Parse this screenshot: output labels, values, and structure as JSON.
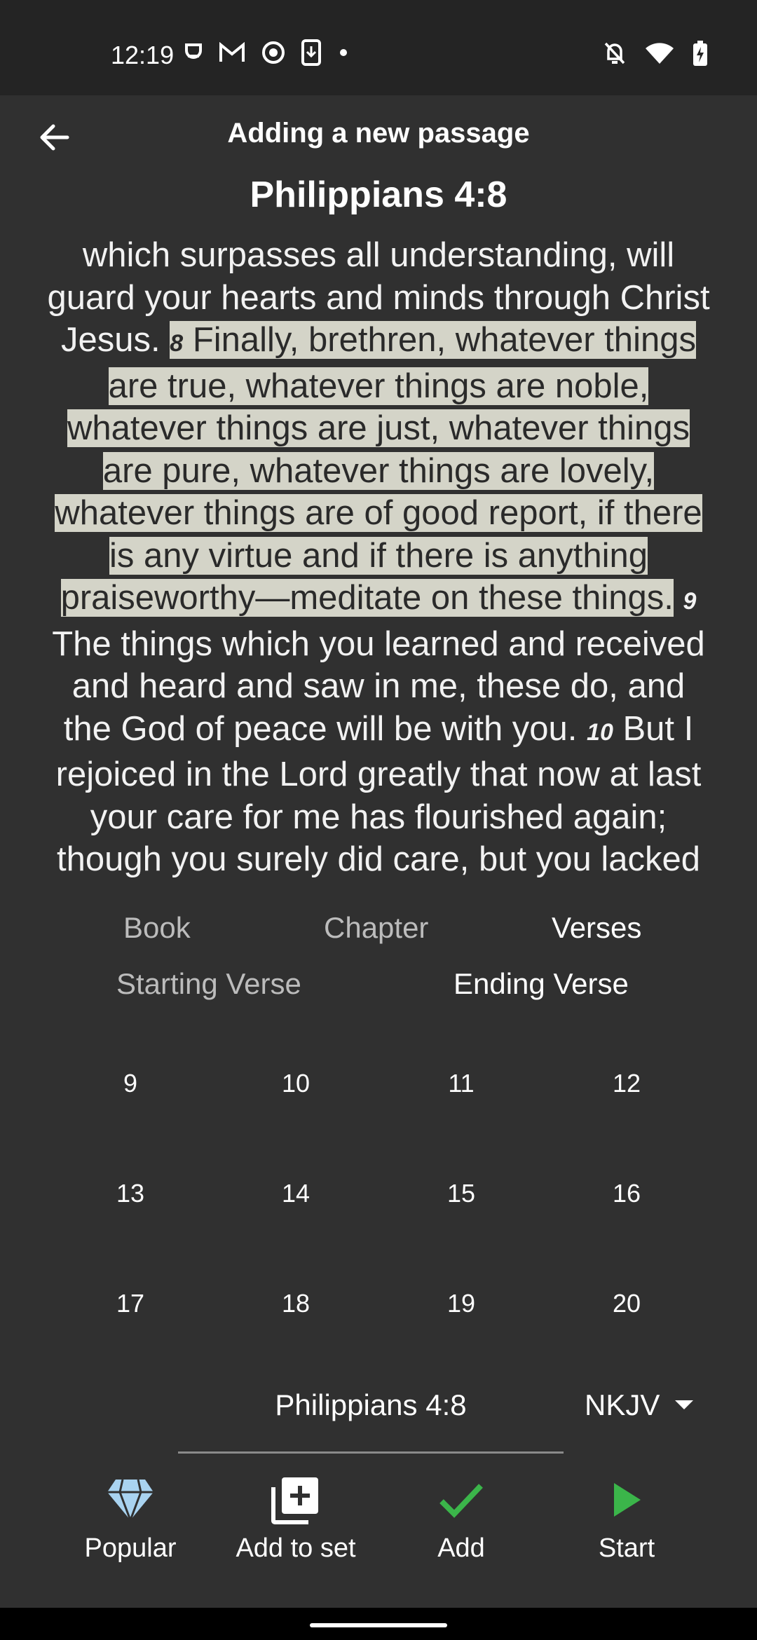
{
  "status": {
    "time": "12:19"
  },
  "header": {
    "title": "Adding a new passage"
  },
  "passage": {
    "reference": "Philippians 4:8",
    "text_before": "which surpasses all understanding, will guard your hearts and minds through Christ Jesus.",
    "highlight_verse_num": "8",
    "highlight_text": "Finally, brethren, whatever things are true, whatever things are noble, whatever things are just, whatever things are pure, whatever things are lovely, whatever things are of good report, if there is any virtue and if there is anything praiseworthy—meditate on these things.",
    "verse9_num": "9",
    "verse9_text": "The things which you learned and received and heard and saw in me, these do, and the God of peace will be with you.",
    "verse10_num": "10",
    "verse10_text": "But I rejoiced in the Lord greatly that now at last your care for me has flourished again; though you surely did care, but you lacked"
  },
  "tabs": {
    "book": "Book",
    "chapter": "Chapter",
    "verses": "Verses"
  },
  "subtabs": {
    "starting": "Starting Verse",
    "ending": "Ending Verse"
  },
  "verses": [
    "9",
    "10",
    "11",
    "12",
    "13",
    "14",
    "15",
    "16",
    "17",
    "18",
    "19",
    "20"
  ],
  "reference_field": {
    "value": "Philippians 4:8"
  },
  "translation": {
    "value": "NKJV"
  },
  "actions": {
    "popular": "Popular",
    "add_to_set": "Add to set",
    "add": "Add",
    "start": "Start"
  },
  "colors": {
    "background": "#303030",
    "highlight": "#d4d4c8",
    "gem": "#a9d3f0",
    "accent_green": "#3bb54a"
  }
}
